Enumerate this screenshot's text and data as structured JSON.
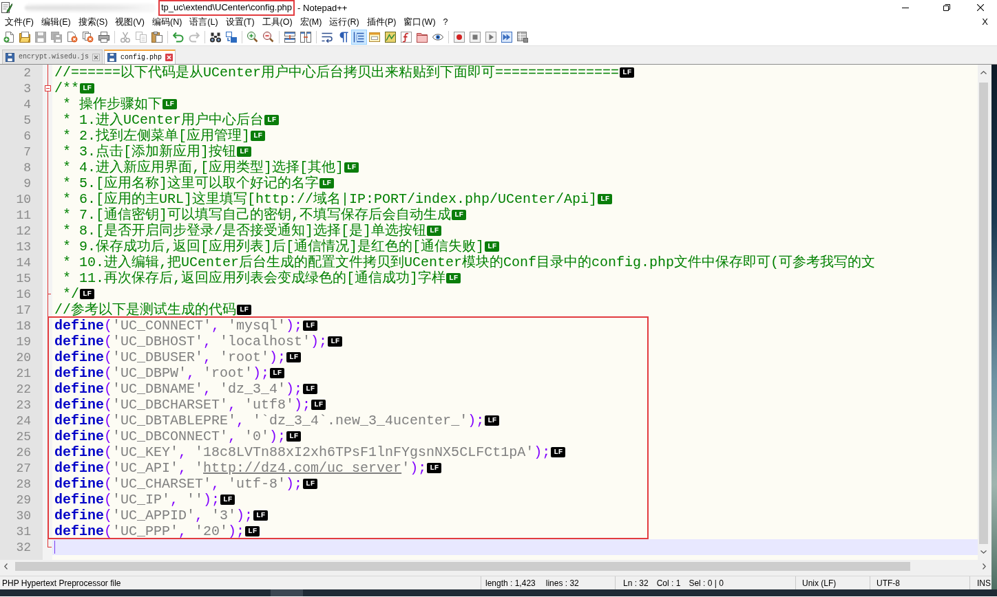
{
  "window": {
    "path": "tp_uc\\extend\\UCenter\\config.php",
    "path_highlighted": true,
    "app": "- Notepad++"
  },
  "menu": {
    "items": [
      "文件(F)",
      "编辑(E)",
      "搜索(S)",
      "视图(V)",
      "编码(N)",
      "语言(L)",
      "设置(T)",
      "工具(O)",
      "宏(M)",
      "运行(R)",
      "插件(P)",
      "窗口(W)",
      "?"
    ],
    "close_label": "X"
  },
  "toolbar": [
    {
      "buttons": [
        {
          "kind": "new",
          "pressed": false,
          "disabled": false
        },
        {
          "kind": "open",
          "pressed": false,
          "disabled": false
        },
        {
          "kind": "save",
          "pressed": false,
          "disabled": true
        },
        {
          "kind": "save_all",
          "pressed": false,
          "disabled": true
        },
        {
          "kind": "close",
          "pressed": false,
          "disabled": false
        },
        {
          "kind": "close_all",
          "pressed": false,
          "disabled": false
        },
        {
          "kind": "print",
          "pressed": false,
          "disabled": false
        }
      ]
    },
    {
      "buttons": [
        {
          "kind": "cut",
          "pressed": false,
          "disabled": true
        },
        {
          "kind": "copy",
          "pressed": false,
          "disabled": true
        },
        {
          "kind": "paste",
          "pressed": false,
          "disabled": false
        }
      ]
    },
    {
      "buttons": [
        {
          "kind": "undo",
          "pressed": false,
          "disabled": false
        },
        {
          "kind": "redo",
          "pressed": false,
          "disabled": true
        }
      ]
    },
    {
      "buttons": [
        {
          "kind": "find",
          "pressed": false,
          "disabled": false
        },
        {
          "kind": "replace",
          "pressed": false,
          "disabled": false
        }
      ]
    },
    {
      "buttons": [
        {
          "kind": "zoom_in",
          "pressed": false,
          "disabled": false
        },
        {
          "kind": "zoom_out",
          "pressed": false,
          "disabled": false
        }
      ]
    },
    {
      "buttons": [
        {
          "kind": "sync_vertical",
          "pressed": false,
          "disabled": false
        },
        {
          "kind": "sync_horizontal",
          "pressed": false,
          "disabled": false
        }
      ]
    },
    {
      "buttons": [
        {
          "kind": "word_wrap",
          "pressed": false,
          "disabled": false
        },
        {
          "kind": "show_all",
          "pressed": false,
          "disabled": false
        },
        {
          "kind": "indent_guide",
          "pressed": true,
          "disabled": false
        },
        {
          "kind": "user_language",
          "pressed": false,
          "disabled": false
        },
        {
          "kind": "document_map",
          "pressed": false,
          "disabled": false
        },
        {
          "kind": "function_list",
          "pressed": false,
          "disabled": false
        },
        {
          "kind": "folder_workspace",
          "pressed": false,
          "disabled": false
        },
        {
          "kind": "monitoring",
          "pressed": false,
          "disabled": false
        }
      ]
    },
    {
      "buttons": [
        {
          "kind": "record",
          "pressed": false,
          "disabled": false
        },
        {
          "kind": "stop",
          "pressed": false,
          "disabled": false
        },
        {
          "kind": "play",
          "pressed": false,
          "disabled": false
        },
        {
          "kind": "play_multiple",
          "pressed": false,
          "disabled": false
        },
        {
          "kind": "save_macro",
          "pressed": false,
          "disabled": false
        }
      ]
    }
  ],
  "tabs": [
    {
      "label": "encrypt.wisedu.js",
      "selected": false
    },
    {
      "label": "config.php",
      "selected": true
    }
  ],
  "editor": {
    "sections": [
      {
        "highlighted": false,
        "lines": [
          {
            "number": "2",
            "current": false,
            "fold": {
              "kind": "line"
            },
            "tokens": [
              {
                "kind": "comment",
                "text": "//======以下代码是从UCenter用户中心后台拷贝出来粘贴到下面即可==============="
              }
            ],
            "eol": {
              "kind": "plain",
              "text": "LF"
            }
          },
          {
            "number": "3",
            "current": false,
            "fold": {
              "kind": "open"
            },
            "tokens": [
              {
                "kind": "comment",
                "text": "/**"
              }
            ],
            "eol": {
              "kind": "doc",
              "text": "LF"
            }
          },
          {
            "number": "4",
            "current": false,
            "fold": {
              "kind": "line"
            },
            "tokens": [
              {
                "kind": "comment",
                "text": " * 操作步骤如下"
              }
            ],
            "eol": {
              "kind": "doc",
              "text": "LF"
            }
          },
          {
            "number": "5",
            "current": false,
            "fold": {
              "kind": "line"
            },
            "tokens": [
              {
                "kind": "comment",
                "text": " * 1.进入UCenter用户中心后台"
              }
            ],
            "eol": {
              "kind": "doc",
              "text": "LF"
            }
          },
          {
            "number": "6",
            "current": false,
            "fold": {
              "kind": "line"
            },
            "tokens": [
              {
                "kind": "comment",
                "text": " * 2.找到左侧菜单[应用管理]"
              }
            ],
            "eol": {
              "kind": "doc",
              "text": "LF"
            }
          },
          {
            "number": "7",
            "current": false,
            "fold": {
              "kind": "line"
            },
            "tokens": [
              {
                "kind": "comment",
                "text": " * 3.点击[添加新应用]按钮"
              }
            ],
            "eol": {
              "kind": "doc",
              "text": "LF"
            }
          },
          {
            "number": "8",
            "current": false,
            "fold": {
              "kind": "line"
            },
            "tokens": [
              {
                "kind": "comment",
                "text": " * 4.进入新应用界面,[应用类型]选择[其他]"
              }
            ],
            "eol": {
              "kind": "doc",
              "text": "LF"
            }
          },
          {
            "number": "9",
            "current": false,
            "fold": {
              "kind": "line"
            },
            "tokens": [
              {
                "kind": "comment",
                "text": " * 5.[应用名称]这里可以取个好记的名字"
              }
            ],
            "eol": {
              "kind": "doc",
              "text": "LF"
            }
          },
          {
            "number": "10",
            "current": false,
            "fold": {
              "kind": "line"
            },
            "tokens": [
              {
                "kind": "comment",
                "text": " * 6.[应用的主URL]这里填写[http://域名|IP:PORT/index.php/UCenter/Api]"
              }
            ],
            "eol": {
              "kind": "doc",
              "text": "LF"
            }
          },
          {
            "number": "11",
            "current": false,
            "fold": {
              "kind": "line"
            },
            "tokens": [
              {
                "kind": "comment",
                "text": " * 7.[通信密钥]可以填写自己的密钥,不填写保存后会自动生成"
              }
            ],
            "eol": {
              "kind": "doc",
              "text": "LF"
            }
          },
          {
            "number": "12",
            "current": false,
            "fold": {
              "kind": "line"
            },
            "tokens": [
              {
                "kind": "comment",
                "text": " * 8.[是否开启同步登录/是否接受通知]选择[是]单选按钮"
              }
            ],
            "eol": {
              "kind": "doc",
              "text": "LF"
            }
          },
          {
            "number": "13",
            "current": false,
            "fold": {
              "kind": "line"
            },
            "tokens": [
              {
                "kind": "comment",
                "text": " * 9.保存成功后,返回[应用列表]后[通信情况]是红色的[通信失败]"
              }
            ],
            "eol": {
              "kind": "doc",
              "text": "LF"
            }
          },
          {
            "number": "14",
            "current": false,
            "fold": {
              "kind": "line"
            },
            "tokens": [
              {
                "kind": "comment",
                "text": " * 10.进入编辑,把UCenter后台生成的配置文件拷贝到UCenter模块的Conf目录中的config.php文件中保存即可(可参考我写的文"
              }
            ]
          },
          {
            "number": "15",
            "current": false,
            "fold": {
              "kind": "line"
            },
            "tokens": [
              {
                "kind": "comment",
                "text": " * 11.再次保存后,返回应用列表会变成绿色的[通信成功]字样"
              }
            ],
            "eol": {
              "kind": "doc",
              "text": "LF"
            }
          },
          {
            "number": "16",
            "current": false,
            "fold": {
              "kind": "close"
            },
            "tokens": [
              {
                "kind": "comment",
                "text": " */"
              }
            ],
            "eol": {
              "kind": "plain",
              "text": "LF"
            }
          },
          {
            "number": "17",
            "current": false,
            "fold": {
              "kind": "line"
            },
            "tokens": [
              {
                "kind": "comment",
                "text": "//参考以下是测试生成的代码"
              }
            ],
            "eol": {
              "kind": "plain",
              "text": "LF"
            }
          }
        ]
      },
      {
        "highlighted": true,
        "lines": [
          {
            "number": "18",
            "current": false,
            "fold": {
              "kind": "line"
            },
            "tokens": [
              {
                "kind": "keyword",
                "text": "define"
              },
              {
                "kind": "operator",
                "text": "("
              },
              {
                "kind": "string",
                "text": "'UC_CONNECT'"
              },
              {
                "kind": "operator",
                "text": ", "
              },
              {
                "kind": "string",
                "text": "'mysql'"
              },
              {
                "kind": "operator",
                "text": ");"
              }
            ],
            "eol": {
              "kind": "plain",
              "text": "LF"
            }
          },
          {
            "number": "19",
            "current": false,
            "fold": {
              "kind": "line"
            },
            "tokens": [
              {
                "kind": "keyword",
                "text": "define"
              },
              {
                "kind": "operator",
                "text": "("
              },
              {
                "kind": "string",
                "text": "'UC_DBHOST'"
              },
              {
                "kind": "operator",
                "text": ", "
              },
              {
                "kind": "string",
                "text": "'localhost'"
              },
              {
                "kind": "operator",
                "text": ");"
              }
            ],
            "eol": {
              "kind": "plain",
              "text": "LF"
            }
          },
          {
            "number": "20",
            "current": false,
            "fold": {
              "kind": "line"
            },
            "tokens": [
              {
                "kind": "keyword",
                "text": "define"
              },
              {
                "kind": "operator",
                "text": "("
              },
              {
                "kind": "string",
                "text": "'UC_DBUSER'"
              },
              {
                "kind": "operator",
                "text": ", "
              },
              {
                "kind": "string",
                "text": "'root'"
              },
              {
                "kind": "operator",
                "text": ");"
              }
            ],
            "eol": {
              "kind": "plain",
              "text": "LF"
            }
          },
          {
            "number": "21",
            "current": false,
            "fold": {
              "kind": "line"
            },
            "tokens": [
              {
                "kind": "keyword",
                "text": "define"
              },
              {
                "kind": "operator",
                "text": "("
              },
              {
                "kind": "string",
                "text": "'UC_DBPW'"
              },
              {
                "kind": "operator",
                "text": ", "
              },
              {
                "kind": "string",
                "text": "'root'"
              },
              {
                "kind": "operator",
                "text": ");"
              }
            ],
            "eol": {
              "kind": "plain",
              "text": "LF"
            }
          },
          {
            "number": "22",
            "current": false,
            "fold": {
              "kind": "line"
            },
            "tokens": [
              {
                "kind": "keyword",
                "text": "define"
              },
              {
                "kind": "operator",
                "text": "("
              },
              {
                "kind": "string",
                "text": "'UC_DBNAME'"
              },
              {
                "kind": "operator",
                "text": ", "
              },
              {
                "kind": "string",
                "text": "'dz_3_4'"
              },
              {
                "kind": "operator",
                "text": ");"
              }
            ],
            "eol": {
              "kind": "plain",
              "text": "LF"
            }
          },
          {
            "number": "23",
            "current": false,
            "fold": {
              "kind": "line"
            },
            "tokens": [
              {
                "kind": "keyword",
                "text": "define"
              },
              {
                "kind": "operator",
                "text": "("
              },
              {
                "kind": "string",
                "text": "'UC_DBCHARSET'"
              },
              {
                "kind": "operator",
                "text": ", "
              },
              {
                "kind": "string",
                "text": "'utf8'"
              },
              {
                "kind": "operator",
                "text": ");"
              }
            ],
            "eol": {
              "kind": "plain",
              "text": "LF"
            }
          },
          {
            "number": "24",
            "current": false,
            "fold": {
              "kind": "line"
            },
            "tokens": [
              {
                "kind": "keyword",
                "text": "define"
              },
              {
                "kind": "operator",
                "text": "("
              },
              {
                "kind": "string",
                "text": "'UC_DBTABLEPRE'"
              },
              {
                "kind": "operator",
                "text": ", "
              },
              {
                "kind": "string",
                "text": "'`dz_3_4`.new_3_4ucenter_'"
              },
              {
                "kind": "operator",
                "text": ");"
              }
            ],
            "eol": {
              "kind": "plain",
              "text": "LF"
            }
          },
          {
            "number": "25",
            "current": false,
            "fold": {
              "kind": "line"
            },
            "tokens": [
              {
                "kind": "keyword",
                "text": "define"
              },
              {
                "kind": "operator",
                "text": "("
              },
              {
                "kind": "string",
                "text": "'UC_DBCONNECT'"
              },
              {
                "kind": "operator",
                "text": ", "
              },
              {
                "kind": "string",
                "text": "'0'"
              },
              {
                "kind": "operator",
                "text": ");"
              }
            ],
            "eol": {
              "kind": "plain",
              "text": "LF"
            }
          },
          {
            "number": "26",
            "current": false,
            "fold": {
              "kind": "line"
            },
            "tokens": [
              {
                "kind": "keyword",
                "text": "define"
              },
              {
                "kind": "operator",
                "text": "("
              },
              {
                "kind": "string",
                "text": "'UC_KEY'"
              },
              {
                "kind": "operator",
                "text": ", "
              },
              {
                "kind": "string",
                "text": "'18c8LVTn88xI2xh6TPsF1lnFYgsnNX5CLFCt1pA'"
              },
              {
                "kind": "operator",
                "text": ");"
              }
            ],
            "eol": {
              "kind": "plain",
              "text": "LF"
            }
          },
          {
            "number": "27",
            "current": false,
            "fold": {
              "kind": "line"
            },
            "tokens": [
              {
                "kind": "keyword",
                "text": "define"
              },
              {
                "kind": "operator",
                "text": "("
              },
              {
                "kind": "string",
                "text": "'UC_API'"
              },
              {
                "kind": "operator",
                "text": ", "
              },
              {
                "kind": "string",
                "text": "'"
              },
              {
                "kind": "link",
                "text": "http://dz4.com/uc_server"
              },
              {
                "kind": "string",
                "text": "'"
              },
              {
                "kind": "operator",
                "text": ");"
              }
            ],
            "eol": {
              "kind": "plain",
              "text": "LF"
            }
          },
          {
            "number": "28",
            "current": false,
            "fold": {
              "kind": "line"
            },
            "tokens": [
              {
                "kind": "keyword",
                "text": "define"
              },
              {
                "kind": "operator",
                "text": "("
              },
              {
                "kind": "string",
                "text": "'UC_CHARSET'"
              },
              {
                "kind": "operator",
                "text": ", "
              },
              {
                "kind": "string",
                "text": "'utf-8'"
              },
              {
                "kind": "operator",
                "text": ");"
              }
            ],
            "eol": {
              "kind": "plain",
              "text": "LF"
            }
          },
          {
            "number": "29",
            "current": false,
            "fold": {
              "kind": "line"
            },
            "tokens": [
              {
                "kind": "keyword",
                "text": "define"
              },
              {
                "kind": "operator",
                "text": "("
              },
              {
                "kind": "string",
                "text": "'UC_IP'"
              },
              {
                "kind": "operator",
                "text": ", "
              },
              {
                "kind": "string",
                "text": "''"
              },
              {
                "kind": "operator",
                "text": ");"
              }
            ],
            "eol": {
              "kind": "plain",
              "text": "LF"
            }
          },
          {
            "number": "30",
            "current": false,
            "fold": {
              "kind": "line"
            },
            "tokens": [
              {
                "kind": "keyword",
                "text": "define"
              },
              {
                "kind": "operator",
                "text": "("
              },
              {
                "kind": "string",
                "text": "'UC_APPID'"
              },
              {
                "kind": "operator",
                "text": ", "
              },
              {
                "kind": "string",
                "text": "'3'"
              },
              {
                "kind": "operator",
                "text": ");"
              }
            ],
            "eol": {
              "kind": "plain",
              "text": "LF"
            }
          },
          {
            "number": "31",
            "current": false,
            "fold": {
              "kind": "line"
            },
            "tokens": [
              {
                "kind": "keyword",
                "text": "define"
              },
              {
                "kind": "operator",
                "text": "("
              },
              {
                "kind": "string",
                "text": "'UC_PPP'"
              },
              {
                "kind": "operator",
                "text": ", "
              },
              {
                "kind": "string",
                "text": "'20'"
              },
              {
                "kind": "operator",
                "text": ");"
              }
            ],
            "eol": {
              "kind": "plain",
              "text": "LF"
            }
          }
        ]
      },
      {
        "highlighted": false,
        "lines": [
          {
            "number": "32",
            "current": true,
            "fold": {
              "kind": "end"
            }
          }
        ]
      }
    ]
  },
  "status_bar": {
    "file_type": "PHP Hypertext Preprocessor file",
    "length": "length : 1,423",
    "lines": "lines : 32",
    "ln": "Ln : 32",
    "col": "Col : 1",
    "sel": "Sel : 0 | 0",
    "eol": "Unix (LF)",
    "encoding": "UTF-8",
    "mode": "INS"
  }
}
